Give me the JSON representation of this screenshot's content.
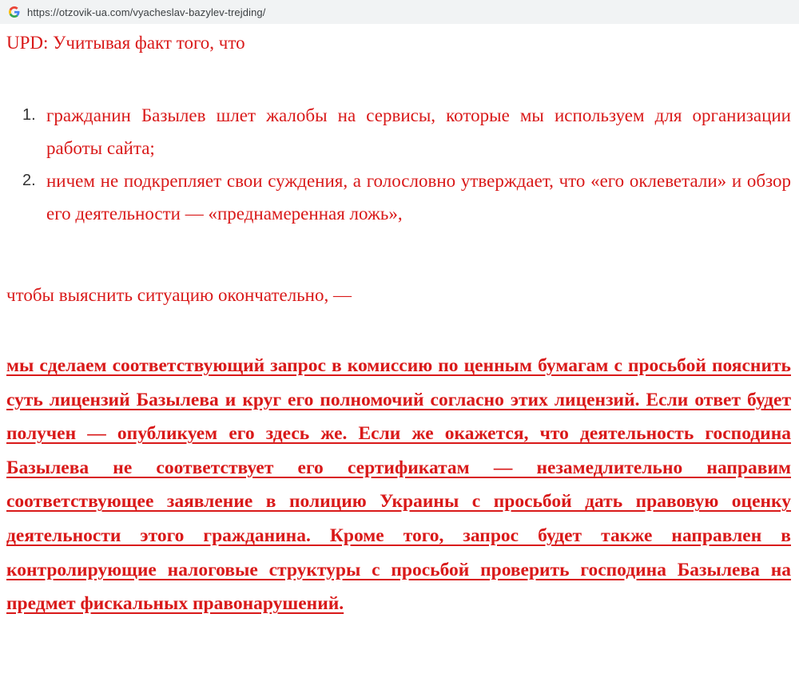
{
  "browser": {
    "url": "https://otzovik-ua.com/vyacheslav-bazylev-trejding/",
    "favicon": "google-g-icon"
  },
  "article": {
    "upd_line": "UPD: Учитывая факт того, что",
    "reasons": [
      {
        "number": "1.",
        "text": "гражданин Базылев шлет жалобы на сервисы, которые мы используем для организации работы сайта;"
      },
      {
        "number": "2.",
        "text": "ничем не подкрепляет свои суждения, а голословно утверждает, что «его оклеветали» и обзор его деятельности — «преднамеренная ложь»,"
      }
    ],
    "to_find_line": "чтобы выяснить ситуацию окончательно, —",
    "bold_statement": "мы сделаем соответствующий запрос в комиссию по ценным бумагам с просьбой пояснить суть лицензий  Базылева и круг его полномочий согласно этих лицензий. Если ответ будет получен — опубликуем его здесь же. Если же окажется, что деятельность господина Базылева не соответствует его сертификатам — незамедлительно направим соответствующее заявление в полицию Украины с просьбой дать правовую оценку деятельности этого гражданина. Кроме того, запрос будет также направлен в контролирующие налоговые структуры с просьбой проверить господина Базылева на предмет фискальных правонарушений."
  },
  "colors": {
    "text_red": "#d91919",
    "list_number": "#333333",
    "url_bar_bg": "#f1f3f4"
  }
}
